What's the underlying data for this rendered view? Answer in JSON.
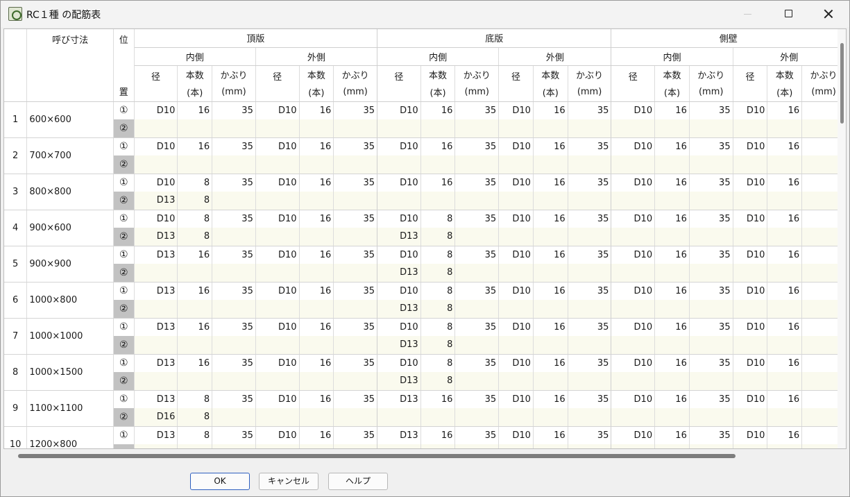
{
  "window": {
    "title": "RC１種 の配筋表"
  },
  "header": {
    "size_label": "呼び寸法",
    "pos_top": "位",
    "pos_bottom": "置",
    "groups": [
      "頂版",
      "底版",
      "側壁"
    ],
    "sides": [
      "内側",
      "外側"
    ],
    "col_diameter": "径",
    "col_count": "本数",
    "col_count_unit": "(本)",
    "col_cover": "かぶり",
    "col_cover_unit": "(mm)"
  },
  "rows": [
    {
      "no": "1",
      "size": "600×600",
      "p1": [
        "D10",
        "16",
        "35",
        "D10",
        "16",
        "35",
        "D10",
        "16",
        "35",
        "D10",
        "16",
        "35",
        "D10",
        "16",
        "35",
        "D10",
        "16",
        ""
      ],
      "p2": [
        "",
        "",
        "",
        "",
        "",
        "",
        "",
        "",
        "",
        "",
        "",
        "",
        "",
        "",
        "",
        "",
        "",
        ""
      ]
    },
    {
      "no": "2",
      "size": "700×700",
      "p1": [
        "D10",
        "16",
        "35",
        "D10",
        "16",
        "35",
        "D10",
        "16",
        "35",
        "D10",
        "16",
        "35",
        "D10",
        "16",
        "35",
        "D10",
        "16",
        ""
      ],
      "p2": [
        "",
        "",
        "",
        "",
        "",
        "",
        "",
        "",
        "",
        "",
        "",
        "",
        "",
        "",
        "",
        "",
        "",
        ""
      ]
    },
    {
      "no": "3",
      "size": "800×800",
      "p1": [
        "D10",
        "8",
        "35",
        "D10",
        "16",
        "35",
        "D10",
        "16",
        "35",
        "D10",
        "16",
        "35",
        "D10",
        "16",
        "35",
        "D10",
        "16",
        ""
      ],
      "p2": [
        "D13",
        "8",
        "",
        "",
        "",
        "",
        "",
        "",
        "",
        "",
        "",
        "",
        "",
        "",
        "",
        "",
        "",
        ""
      ]
    },
    {
      "no": "4",
      "size": "900×600",
      "p1": [
        "D10",
        "8",
        "35",
        "D10",
        "16",
        "35",
        "D10",
        "8",
        "35",
        "D10",
        "16",
        "35",
        "D10",
        "16",
        "35",
        "D10",
        "16",
        ""
      ],
      "p2": [
        "D13",
        "8",
        "",
        "",
        "",
        "",
        "D13",
        "8",
        "",
        "",
        "",
        "",
        "",
        "",
        "",
        "",
        "",
        ""
      ]
    },
    {
      "no": "5",
      "size": "900×900",
      "p1": [
        "D13",
        "16",
        "35",
        "D10",
        "16",
        "35",
        "D10",
        "8",
        "35",
        "D10",
        "16",
        "35",
        "D10",
        "16",
        "35",
        "D10",
        "16",
        ""
      ],
      "p2": [
        "",
        "",
        "",
        "",
        "",
        "",
        "D13",
        "8",
        "",
        "",
        "",
        "",
        "",
        "",
        "",
        "",
        "",
        ""
      ]
    },
    {
      "no": "6",
      "size": "1000×800",
      "p1": [
        "D13",
        "16",
        "35",
        "D10",
        "16",
        "35",
        "D10",
        "8",
        "35",
        "D10",
        "16",
        "35",
        "D10",
        "16",
        "35",
        "D10",
        "16",
        ""
      ],
      "p2": [
        "",
        "",
        "",
        "",
        "",
        "",
        "D13",
        "8",
        "",
        "",
        "",
        "",
        "",
        "",
        "",
        "",
        "",
        ""
      ]
    },
    {
      "no": "7",
      "size": "1000×1000",
      "p1": [
        "D13",
        "16",
        "35",
        "D10",
        "16",
        "35",
        "D10",
        "8",
        "35",
        "D10",
        "16",
        "35",
        "D10",
        "16",
        "35",
        "D10",
        "16",
        ""
      ],
      "p2": [
        "",
        "",
        "",
        "",
        "",
        "",
        "D13",
        "8",
        "",
        "",
        "",
        "",
        "",
        "",
        "",
        "",
        "",
        ""
      ]
    },
    {
      "no": "8",
      "size": "1000×1500",
      "p1": [
        "D13",
        "16",
        "35",
        "D10",
        "16",
        "35",
        "D10",
        "8",
        "35",
        "D10",
        "16",
        "35",
        "D10",
        "16",
        "35",
        "D10",
        "16",
        ""
      ],
      "p2": [
        "",
        "",
        "",
        "",
        "",
        "",
        "D13",
        "8",
        "",
        "",
        "",
        "",
        "",
        "",
        "",
        "",
        "",
        ""
      ]
    },
    {
      "no": "9",
      "size": "1100×1100",
      "p1": [
        "D13",
        "8",
        "35",
        "D10",
        "16",
        "35",
        "D13",
        "16",
        "35",
        "D10",
        "16",
        "35",
        "D10",
        "16",
        "35",
        "D10",
        "16",
        ""
      ],
      "p2": [
        "D16",
        "8",
        "",
        "",
        "",
        "",
        "",
        "",
        "",
        "",
        "",
        "",
        "",
        "",
        "",
        "",
        "",
        ""
      ]
    },
    {
      "no": "10",
      "size": "1200×800",
      "p1": [
        "D13",
        "8",
        "35",
        "D10",
        "16",
        "35",
        "D13",
        "16",
        "35",
        "D10",
        "16",
        "35",
        "D10",
        "16",
        "35",
        "D10",
        "16",
        ""
      ],
      "p2": [
        "",
        "",
        "",
        "",
        "",
        "",
        "",
        "",
        "",
        "",
        "",
        "",
        "",
        "",
        "",
        "",
        "",
        ""
      ]
    }
  ],
  "positions": [
    "①",
    "②"
  ],
  "buttons": {
    "ok": "OK",
    "cancel": "キャンセル",
    "help": "ヘルプ"
  }
}
